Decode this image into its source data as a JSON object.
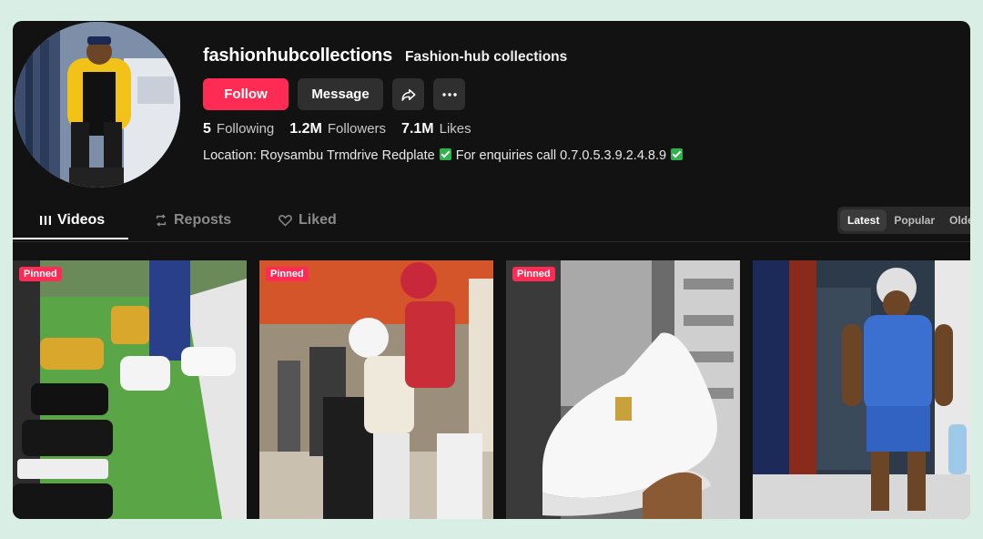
{
  "profile": {
    "username": "fashionhubcollections",
    "nickname": "Fashion-hub collections",
    "follow_label": "Follow",
    "message_label": "Message",
    "share_icon": "share-icon",
    "more_icon": "more-icon",
    "stats": [
      {
        "value": "5",
        "label": "Following"
      },
      {
        "value": "1.2M",
        "label": "Followers"
      },
      {
        "value": "7.1M",
        "label": "Likes"
      }
    ],
    "bio_part1": "Location: Roysambu Trmdrive Redplate",
    "bio_part2": "For enquiries call 0.7.0.5.3.9.2.4.8.9"
  },
  "tabs": [
    {
      "label": "Videos",
      "icon": "grid-icon",
      "active": true
    },
    {
      "label": "Reposts",
      "icon": "repost-icon",
      "active": false
    },
    {
      "label": "Liked",
      "icon": "heart-icon",
      "active": false
    }
  ],
  "sort": {
    "options": [
      "Latest",
      "Popular",
      "Oldest"
    ],
    "selected": "Latest"
  },
  "videos": [
    {
      "pinned_label": "Pinned"
    },
    {
      "pinned_label": "Pinned"
    },
    {
      "pinned_label": "Pinned"
    },
    {
      "pinned_label": ""
    }
  ],
  "colors": {
    "accent": "#fe2c55",
    "background": "#121212",
    "outer": "#d9efe6"
  }
}
